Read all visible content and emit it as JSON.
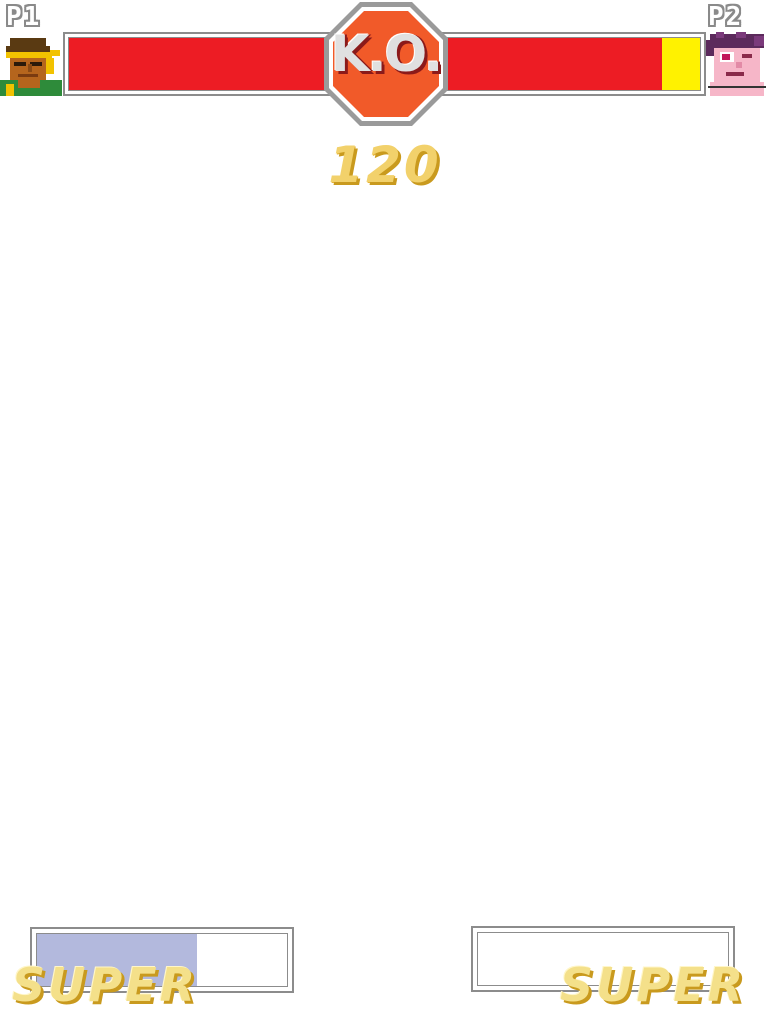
{
  "hud": {
    "p1": {
      "tag": "P1",
      "health_fraction": 0.0,
      "super_fraction": 0.64,
      "super_label": "SUPER"
    },
    "p2": {
      "tag": "P2",
      "health_fraction": 0.15,
      "super_fraction": 0.0,
      "super_label": "SUPER"
    },
    "ko_label": "K.O.",
    "timer": "120",
    "colors": {
      "health_empty": "#ed1c24",
      "health_fill": "#fff200",
      "super_fill": "#b3b9dd",
      "ko_badge": "#f15a29",
      "frame": "#8c8c8c"
    }
  }
}
